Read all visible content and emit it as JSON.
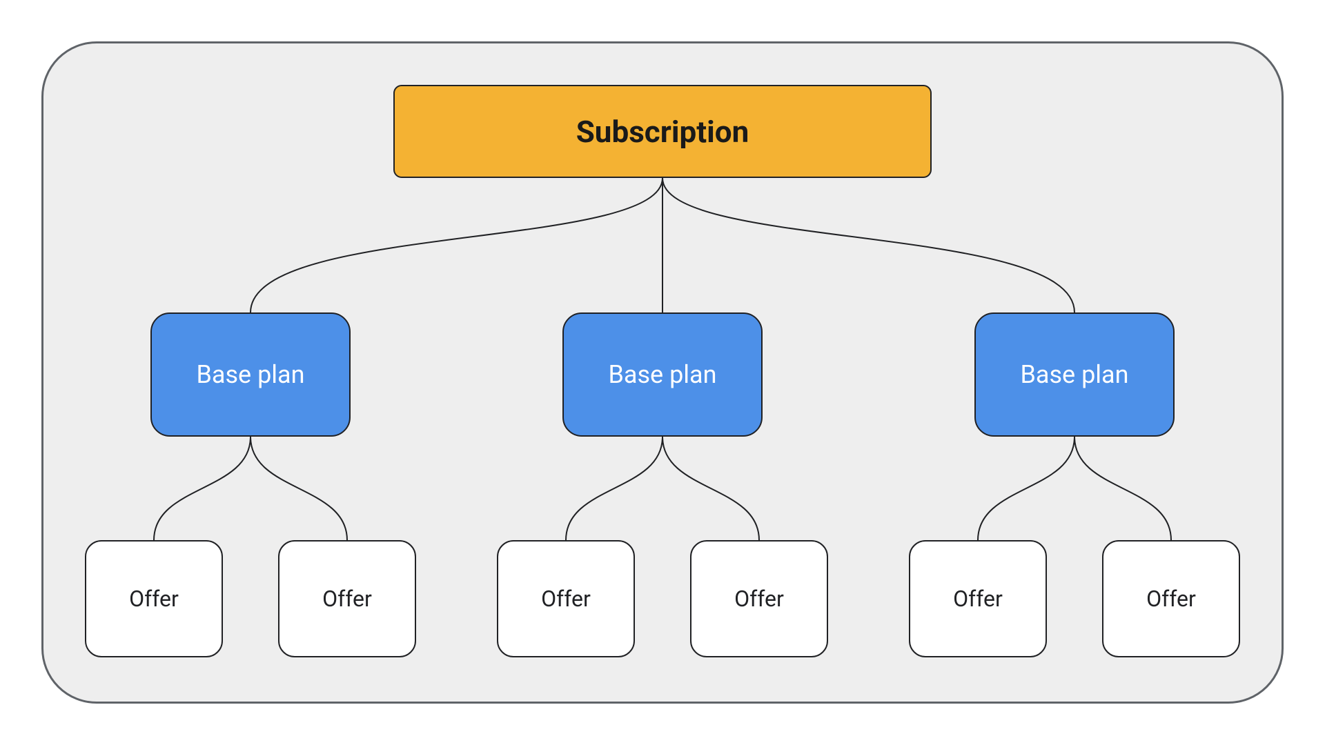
{
  "diagram": {
    "root_label": "Subscription",
    "baseplan_label": "Base plan",
    "offer_label": "Offer",
    "colors": {
      "frame_bg": "#eeeeee",
      "frame_border": "#5f6368",
      "subscription_bg": "#f4b233",
      "baseplan_bg": "#4d90e8",
      "offer_bg": "#ffffff",
      "connector": "#202124"
    },
    "structure": {
      "type": "tree",
      "root": "Subscription",
      "children": [
        {
          "label": "Base plan",
          "children": [
            {
              "label": "Offer"
            },
            {
              "label": "Offer"
            }
          ]
        },
        {
          "label": "Base plan",
          "children": [
            {
              "label": "Offer"
            },
            {
              "label": "Offer"
            }
          ]
        },
        {
          "label": "Base plan",
          "children": [
            {
              "label": "Offer"
            },
            {
              "label": "Offer"
            }
          ]
        }
      ]
    }
  }
}
